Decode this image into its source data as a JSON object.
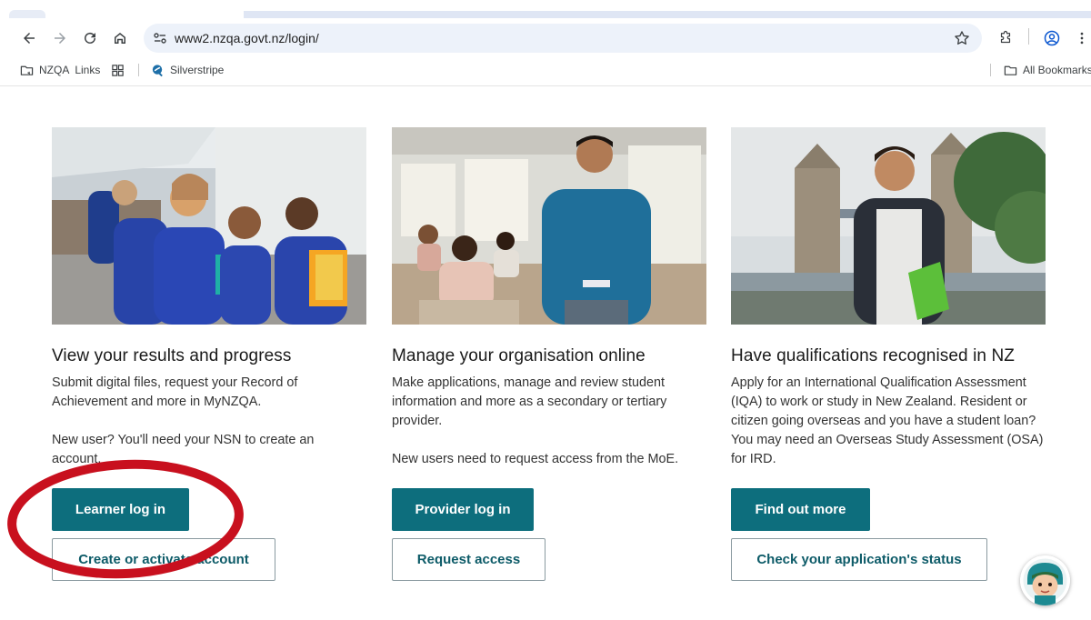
{
  "browser": {
    "url": "www2.nzqa.govt.nz/login/",
    "bookmarks": [
      {
        "label": "NZQA  Links",
        "icon": "bookmark-folder-icon"
      },
      {
        "label": "",
        "icon": "apps-grid-icon"
      },
      {
        "label": "Silverstripe",
        "icon": "silverstripe-logo-icon"
      }
    ],
    "all_bookmarks_label": "All Bookmarks"
  },
  "cards": [
    {
      "title": "View your results and progress",
      "description": "Submit digital files, request your Record of Achievement and more in MyNZQA.",
      "note": "New user? You'll need your NSN to create an account.",
      "primary_button": "Learner log in",
      "secondary_button": "Create or activate account"
    },
    {
      "title": "Manage your organisation online",
      "description": "Make applications, manage and review student information and more as a secondary or tertiary provider.",
      "note": "New users need to request access from the MoE.",
      "primary_button": "Provider log in",
      "secondary_button": "Request access"
    },
    {
      "title": "Have qualifications recognised in NZ",
      "description": "Apply for an International Qualification Assessment (IQA) to work or study in New Zealand. Resident or citizen going overseas and you have a student loan? You may need an Overseas Study Assessment (OSA) for IRD.",
      "primary_button": "Find out more",
      "secondary_button": "Check your application's status"
    }
  ],
  "colors": {
    "primary_button": "#0d6e7d",
    "annotation": "#c8101e"
  }
}
